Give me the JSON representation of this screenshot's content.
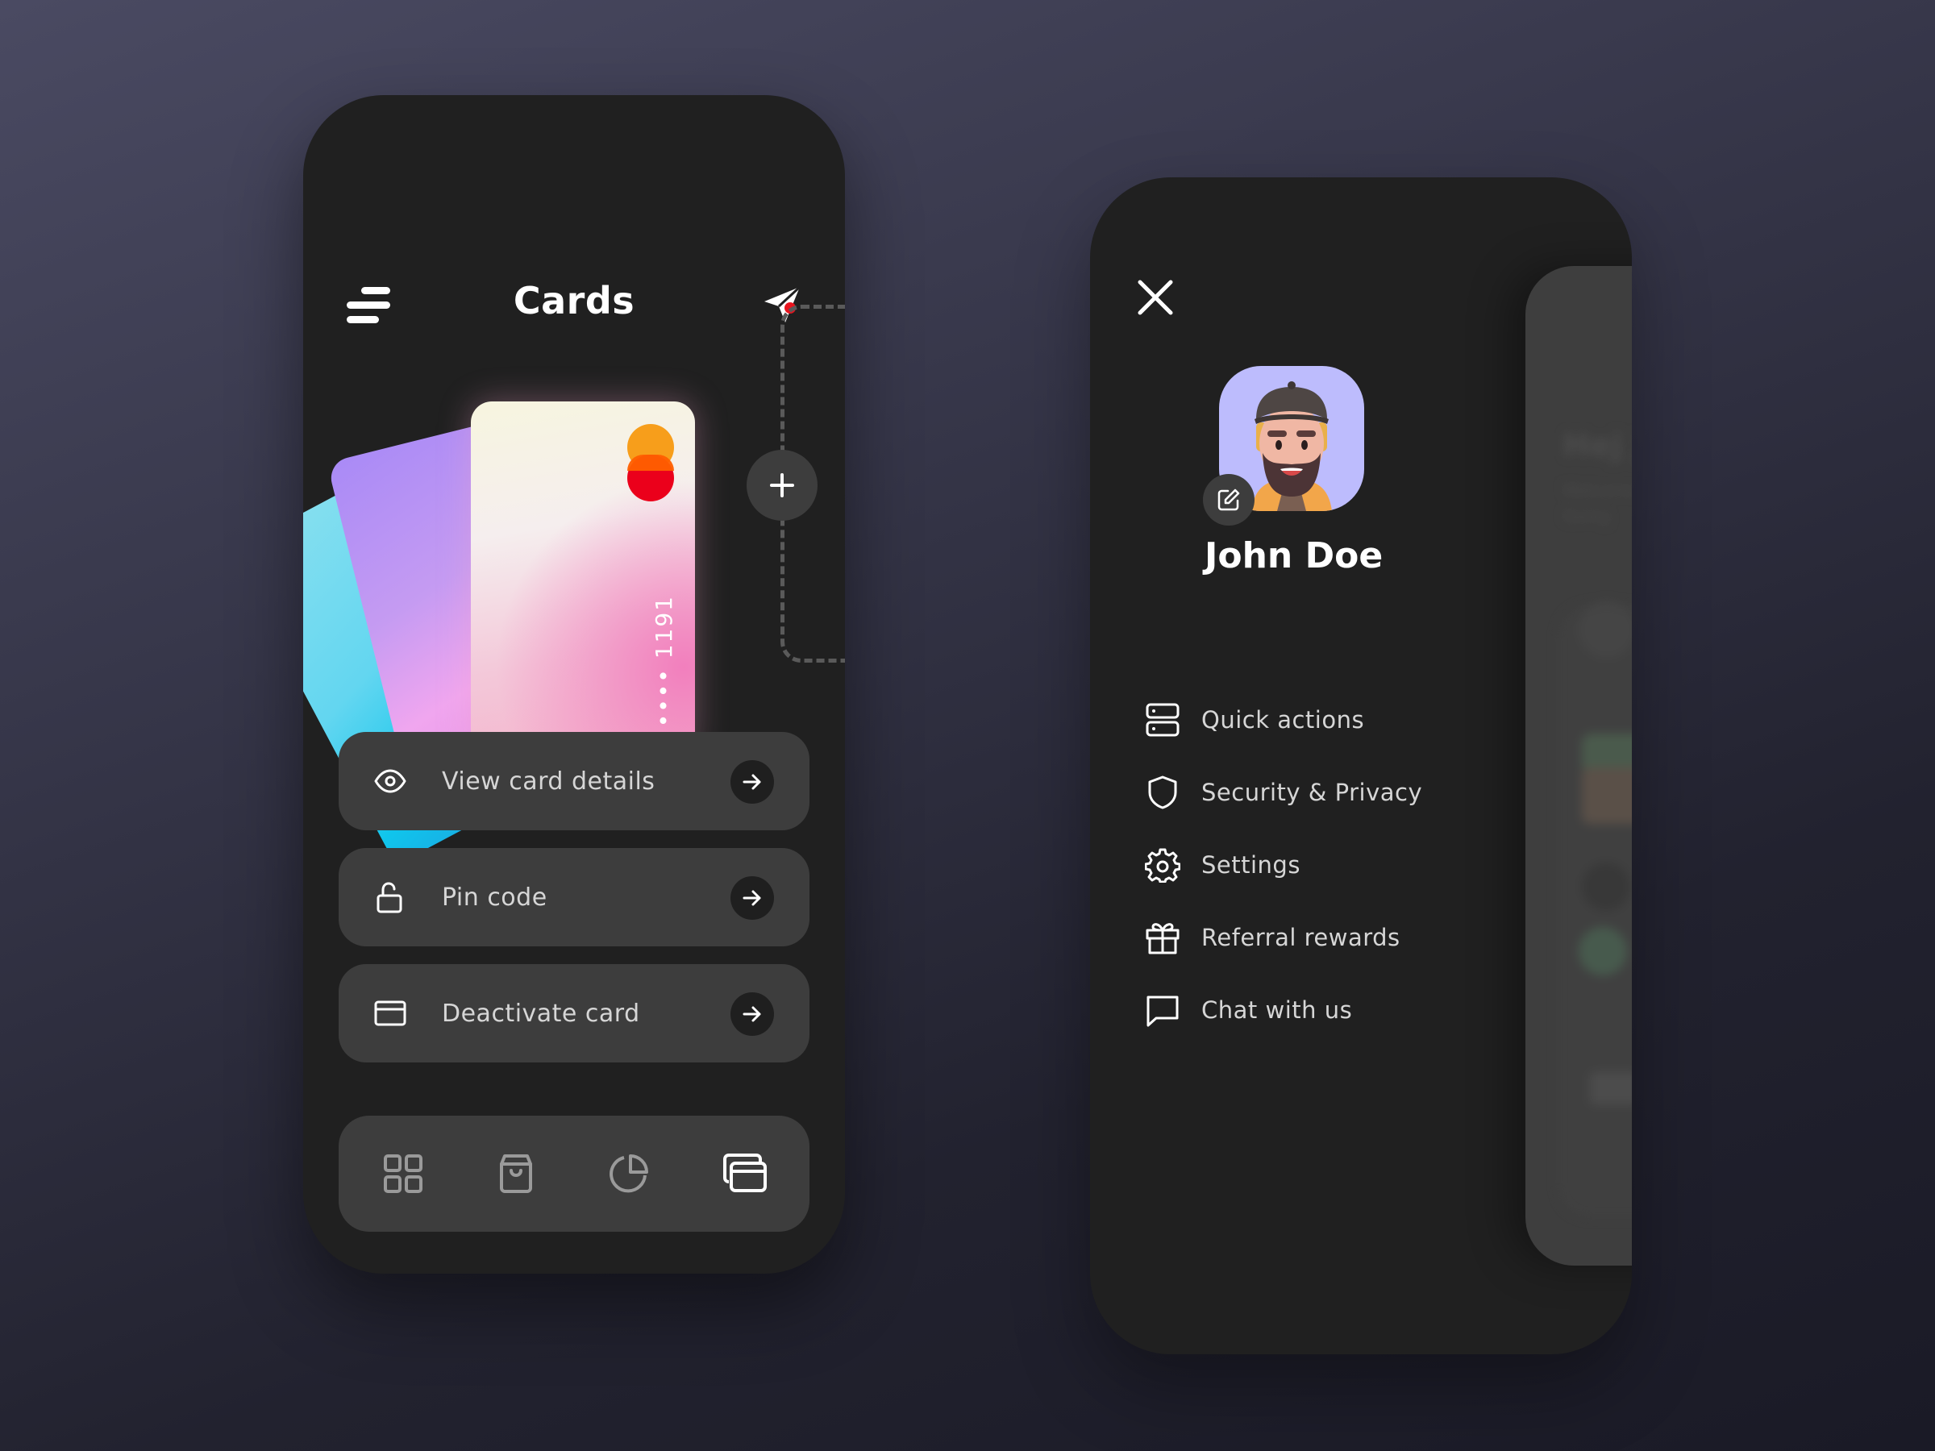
{
  "colors": {
    "phone_bg": "#202020",
    "surface": "#3d3d3d",
    "text_primary": "#ffffff",
    "text_secondary": "#d6d6d6",
    "nav_inactive": "#9a9a9a",
    "notification_dot": "#e8141e",
    "mastercard_orange": "#f79e1b",
    "mastercard_red": "#eb001b",
    "avatar_bg": "#bdbcfd"
  },
  "cards_screen": {
    "title": "Cards",
    "header_left_icon": "menu-icon",
    "header_right_icon": "send-icon",
    "has_notification": true,
    "card": {
      "number_masked": "•••• 1191",
      "network_icon": "mastercard-logo"
    },
    "add_card_icon": "plus-icon",
    "actions": [
      {
        "label": "View card details",
        "icon": "eye-icon"
      },
      {
        "label": "Pin code",
        "icon": "unlock-icon"
      },
      {
        "label": "Deactivate card",
        "icon": "credit-card-icon"
      }
    ],
    "bottom_nav": [
      {
        "name": "dashboard",
        "icon": "grid-icon",
        "active": false
      },
      {
        "name": "shop",
        "icon": "shopping-bag-icon",
        "active": false
      },
      {
        "name": "analytics",
        "icon": "pie-chart-icon",
        "active": false
      },
      {
        "name": "cards",
        "icon": "cards-icon",
        "active": true
      }
    ]
  },
  "menu_screen": {
    "close_icon": "close-icon",
    "user": {
      "name": "John Doe",
      "avatar": "3d-avatar-bearded-man-cap",
      "edit_icon": "edit-icon"
    },
    "items": [
      {
        "label": "Quick actions",
        "icon": "server-icon"
      },
      {
        "label": "Security & Privacy",
        "icon": "shield-icon"
      },
      {
        "label": "Settings",
        "icon": "gear-icon"
      },
      {
        "label": "Referral rewards",
        "icon": "gift-icon"
      },
      {
        "label": "Chat with us",
        "icon": "chat-icon"
      }
    ],
    "background_screen": {
      "greeting": "Hej J",
      "sub1": "Welcome",
      "sub2": "Going"
    }
  }
}
